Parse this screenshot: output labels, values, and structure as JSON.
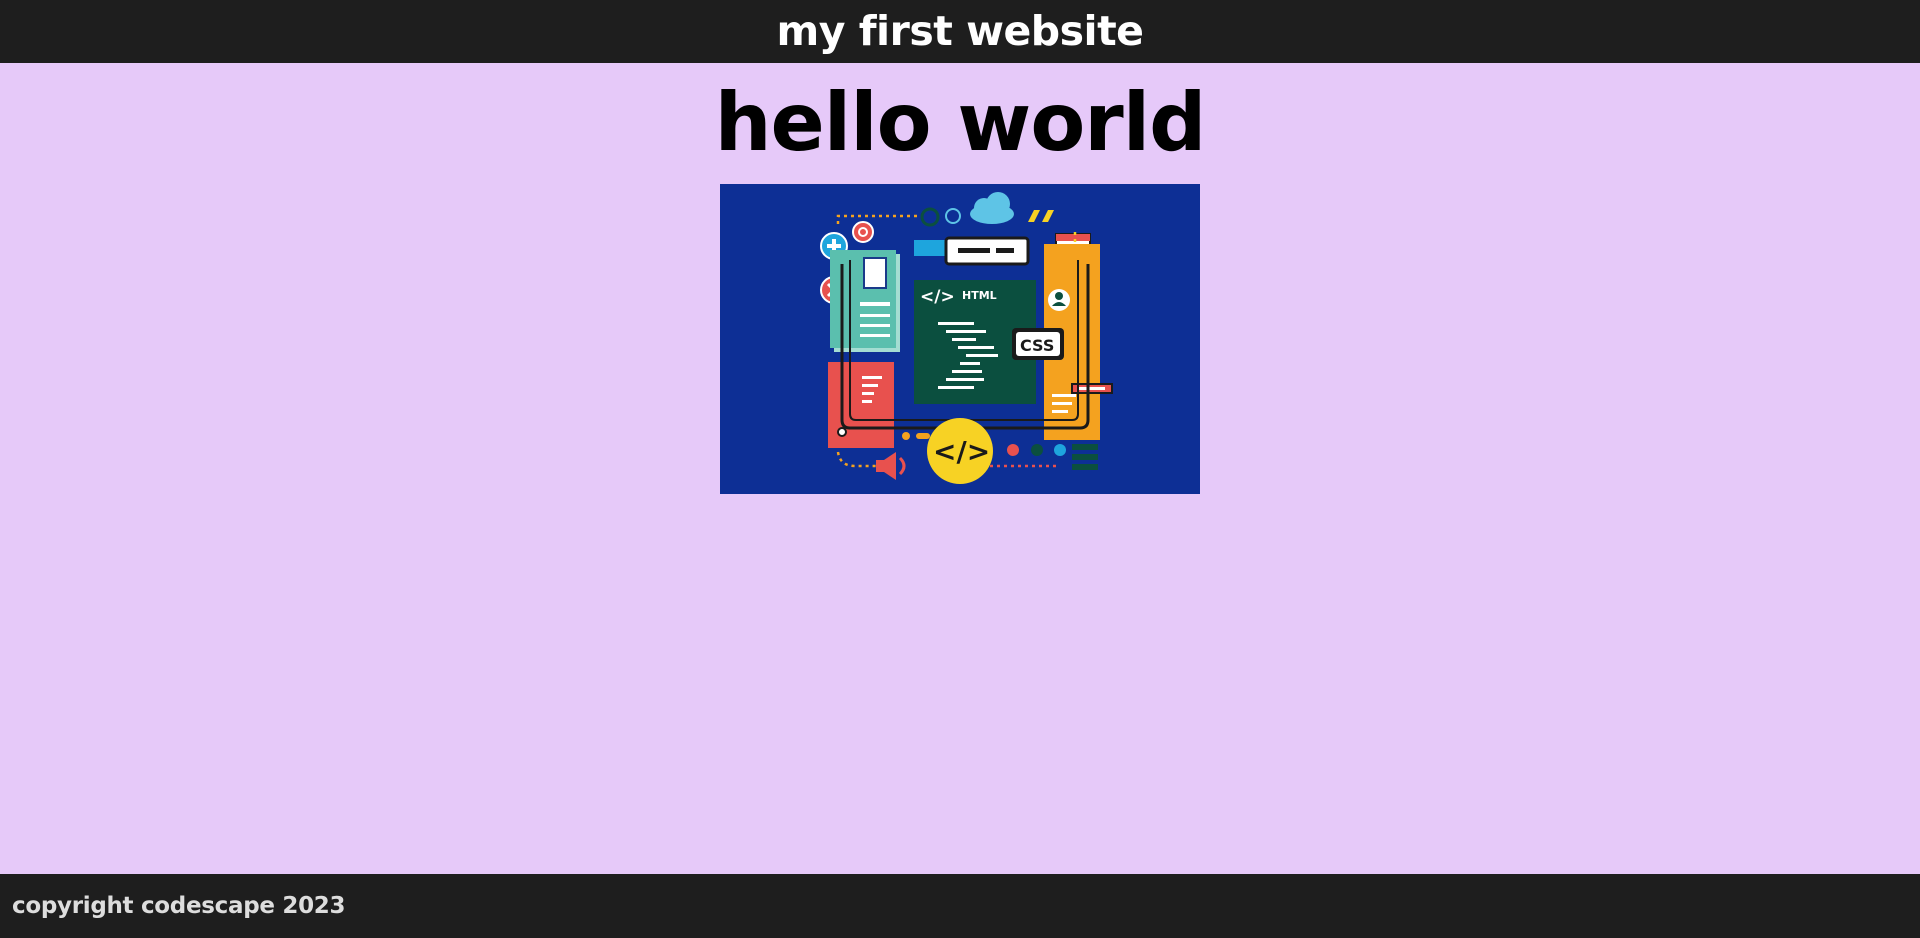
{
  "header": {
    "title": "my first website"
  },
  "main": {
    "heading": "hello world",
    "hero_image": {
      "html_label": "HTML",
      "code_tag": "</>",
      "css_label": "CSS",
      "colors": {
        "background": "#0d2f95",
        "editor": "#0b4f3f",
        "yellow": "#f7d224",
        "orange": "#f4a21f",
        "red": "#e8514e",
        "teal": "#5bbfae",
        "light_blue": "#5ec4e6"
      }
    }
  },
  "footer": {
    "copyright": "copyright codescape 2023"
  }
}
